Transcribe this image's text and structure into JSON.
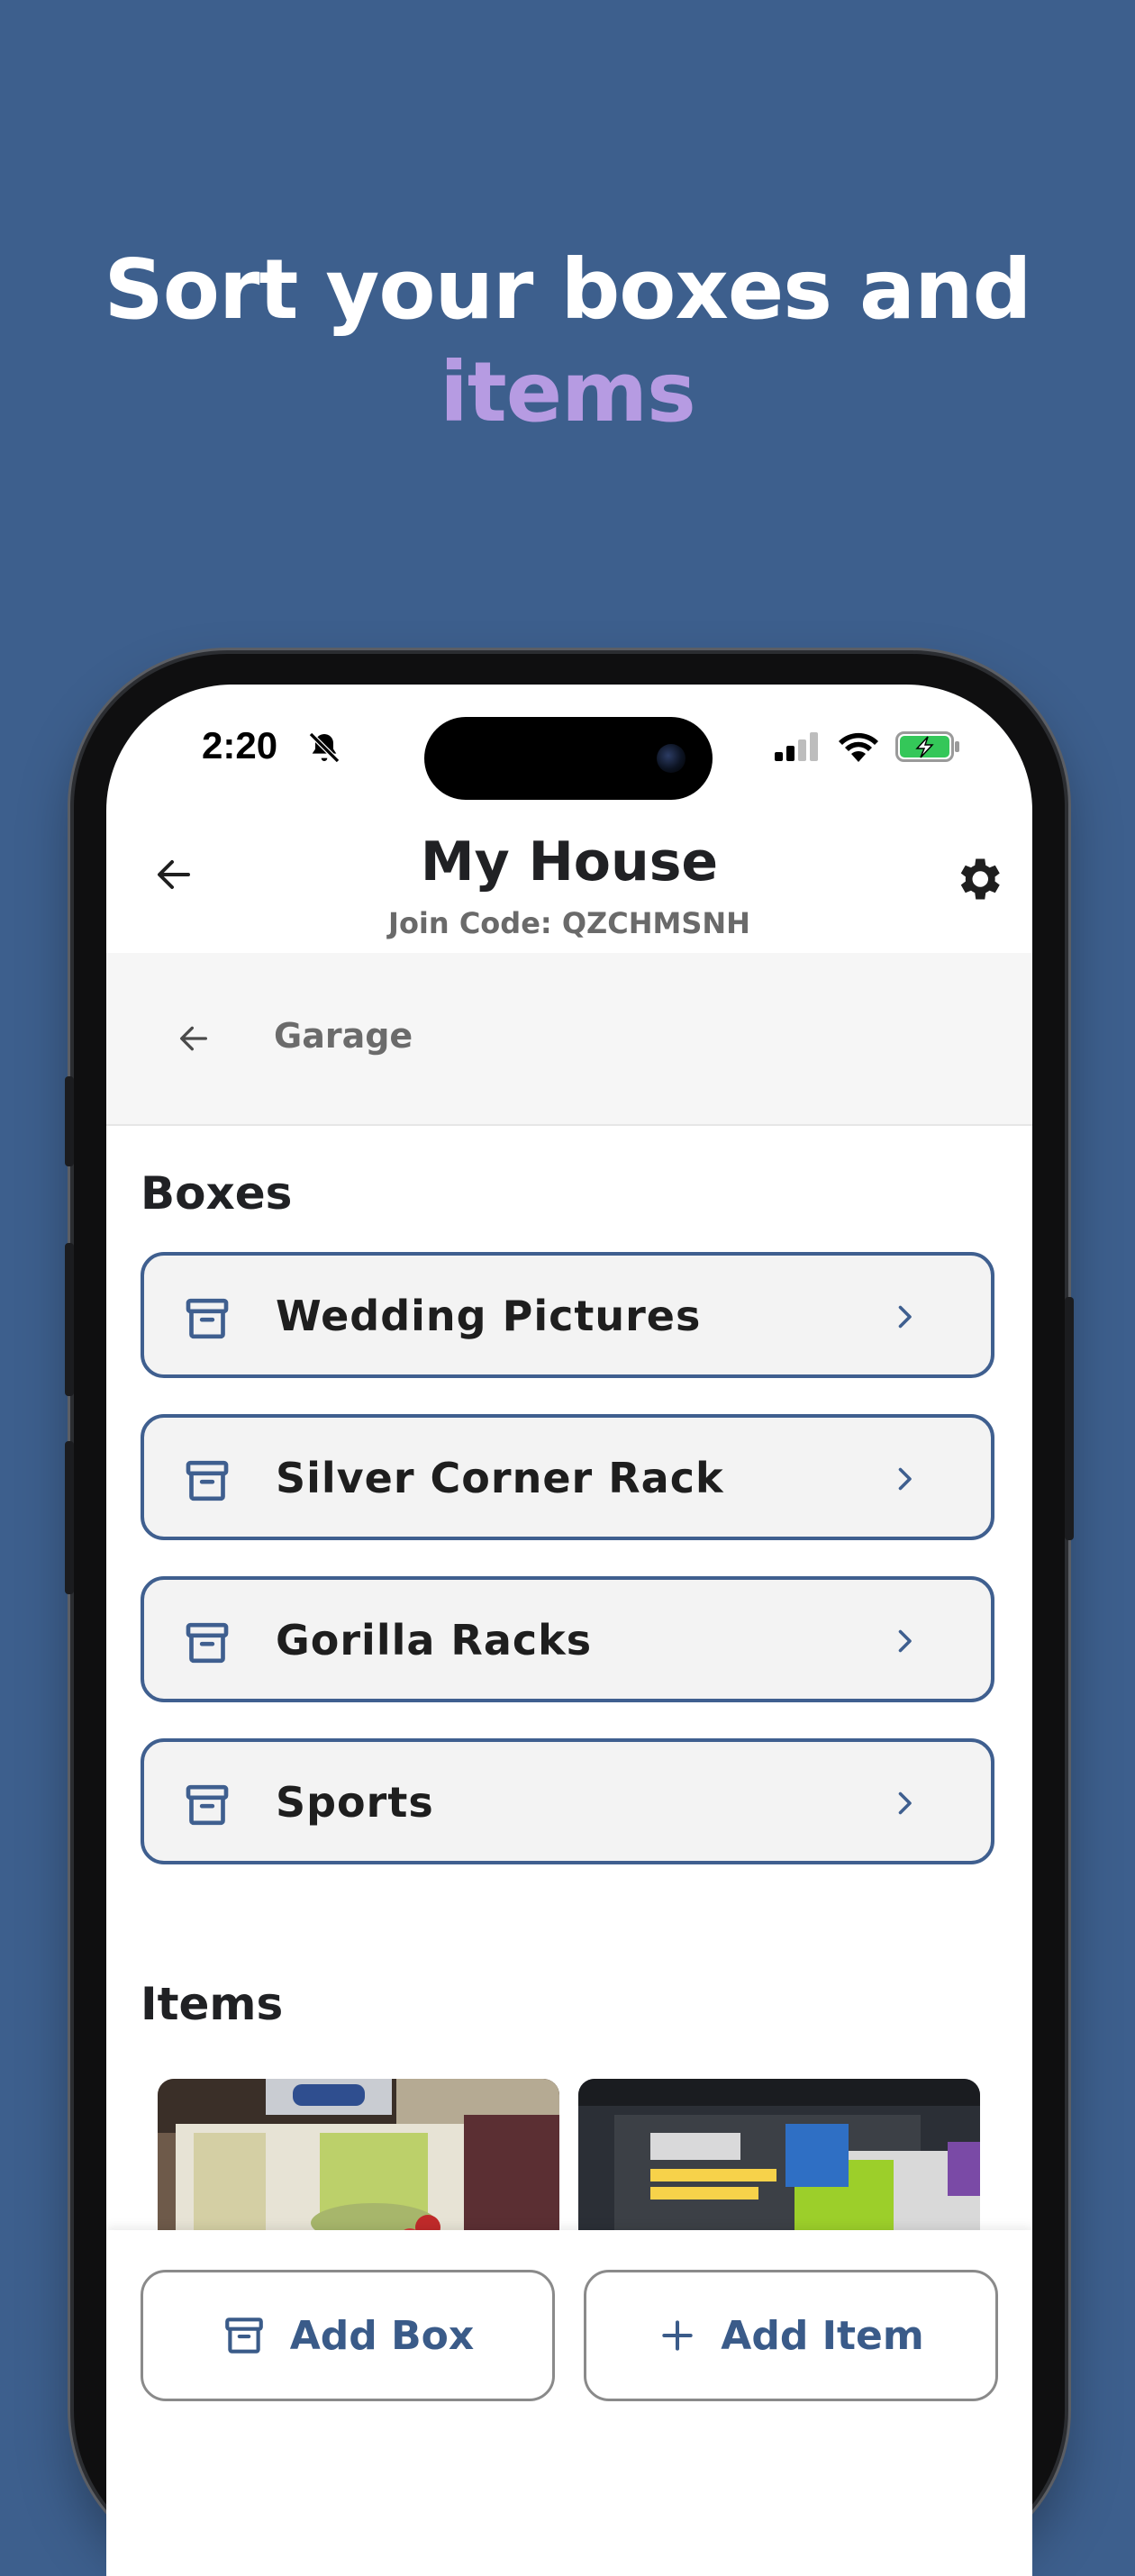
{
  "headline": {
    "line1": "Sort your boxes and",
    "line2": "items"
  },
  "status_bar": {
    "time": "2:20"
  },
  "header": {
    "title": "My House",
    "join_code": "Join Code: QZCHMSNH"
  },
  "breadcrumb": {
    "label": "Garage"
  },
  "boxes": {
    "title": "Boxes",
    "list": [
      {
        "label": "Wedding Pictures"
      },
      {
        "label": "Silver Corner Rack"
      },
      {
        "label": "Gorilla Racks"
      },
      {
        "label": "Sports"
      }
    ]
  },
  "items": {
    "title": "Items"
  },
  "actions": {
    "add_box": "Add Box",
    "add_item": "Add Item"
  },
  "colors": {
    "background": "#3d5f8d",
    "accent": "#b69be2",
    "primary": "#3f5f8f"
  }
}
